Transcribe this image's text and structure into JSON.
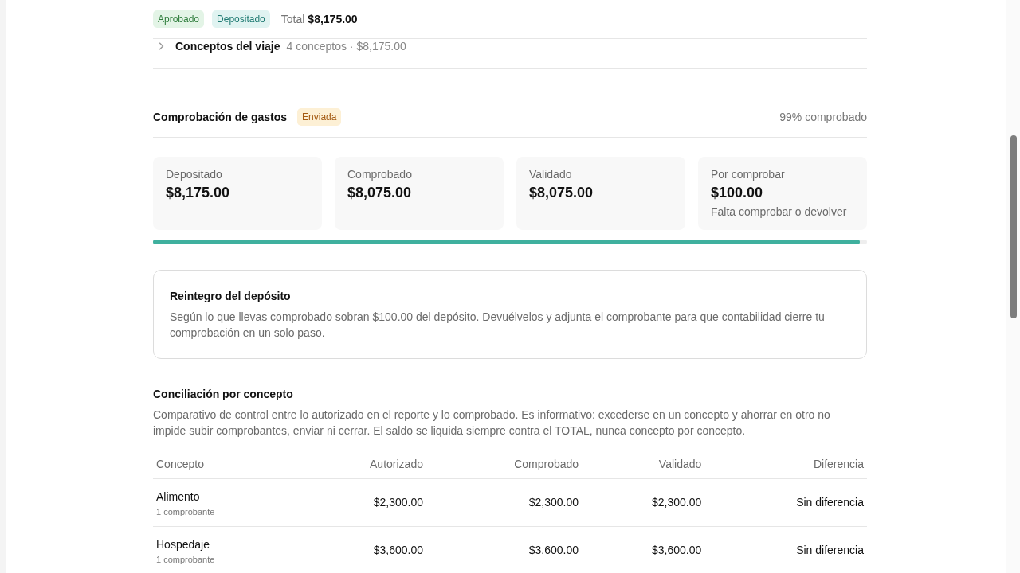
{
  "header": {
    "badges": [
      {
        "label": "Aprobado",
        "color": "#e3f4e6"
      },
      {
        "label": "Depositado",
        "color": "#e0f3f1"
      }
    ],
    "total_label": "Total",
    "total_value": "$8,175.00"
  },
  "trip_concepts": {
    "title": "Conceptos del viaje",
    "summary": "4 conceptos · $8,175.00",
    "expanded": false
  },
  "verification": {
    "title": "Comprobación de gastos",
    "status": {
      "label": "Enviada",
      "color": "#fdf0d5"
    },
    "percent_text": "99% comprobado",
    "cards": [
      {
        "label": "Depositado",
        "amount": "$8,175.00"
      },
      {
        "label": "Comprobado",
        "amount": "$8,075.00"
      },
      {
        "label": "Validado",
        "amount": "$8,075.00"
      },
      {
        "label": "Por comprobar",
        "amount": "$100.00",
        "note": "Falta comprobar o devolver"
      }
    ],
    "progress": {
      "level": 0.99
    }
  },
  "refund_notice": {
    "title": "Reintegro del depósito",
    "text": "Según lo que llevas comprobado sobran $100.00 del depósito. Devuélvelos y adjunta el comprobante para que contabilidad cierre tu comprobación en un solo paso."
  },
  "reconciliation": {
    "title": "Conciliación por concepto",
    "description": "Comparativo de control entre lo autorizado en el reporte y lo comprobado. Es informativo: excederse en un concepto y ahorrar en otro no impide subir comprobantes, enviar ni cerrar. El saldo se liquida siempre contra el TOTAL, nunca concepto por concepto.",
    "table": {
      "columns": [
        "Concepto",
        "Autorizado",
        "Comprobado",
        "Validado",
        "Diferencia"
      ],
      "rows": [
        {
          "concept": "Alimento",
          "receipts": "1 comprobante",
          "authorized": "$2,300.00",
          "verified": "$2,300.00",
          "validated": "$2,300.00",
          "difference": "Sin diferencia"
        },
        {
          "concept": "Hospedaje",
          "receipts": "1 comprobante",
          "authorized": "$3,600.00",
          "verified": "$3,600.00",
          "validated": "$3,600.00",
          "difference": "Sin diferencia"
        }
      ]
    }
  }
}
